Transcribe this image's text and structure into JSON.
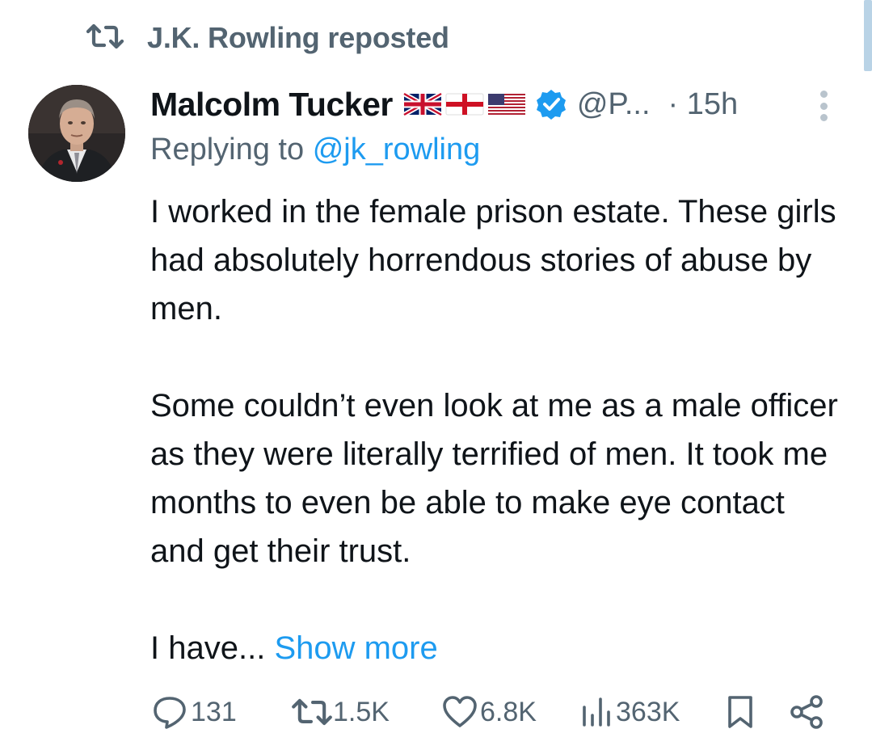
{
  "repost": {
    "icon": "repost-icon",
    "text": "J.K. Rowling reposted"
  },
  "tweet": {
    "author_name": "Malcolm Tucker",
    "flags": [
      "uk-flag-icon",
      "england-flag-icon",
      "us-flag-icon"
    ],
    "verified_icon": "verified-badge-icon",
    "handle": "@P...",
    "time": "· 15h",
    "reply_prefix": "Replying to",
    "reply_to": "@jk_rowling",
    "paragraphs": [
      "I worked in the female prison estate. These girls had absolutely horrendous stories of abuse by men.",
      "Some couldn’t even look at me as a male officer as they were literally terrified of men. It took me months to even be able to make eye contact and get their trust."
    ],
    "truncated_text": "I have...",
    "show_more": "Show more"
  },
  "actions": {
    "replies": "131",
    "reposts": "1.5K",
    "likes": "6.8K",
    "views": "363K"
  },
  "colors": {
    "text": "#0f1419",
    "muted": "#536471",
    "link": "#1d9bf0",
    "verified": "#1d9bf0"
  }
}
